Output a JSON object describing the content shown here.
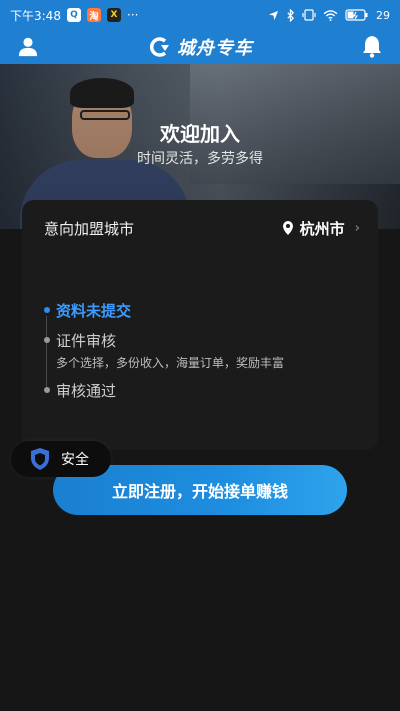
{
  "status_bar": {
    "time": "下午3:48",
    "more": "···",
    "battery": "29"
  },
  "header": {
    "brand": "城舟专车"
  },
  "hero": {
    "title": "欢迎加入",
    "subtitle": "时间灵活，多劳多得"
  },
  "city": {
    "label": "意向加盟城市",
    "value": "杭州市"
  },
  "steps": [
    {
      "label": "资料未提交",
      "active": true
    },
    {
      "label": "证件审核",
      "description": "多个选择，多份收入，海量订单，奖励丰富"
    },
    {
      "label": "审核通过"
    }
  ],
  "safety": {
    "label": "安全"
  },
  "cta": {
    "label": "立即注册，开始接单赚钱"
  },
  "colors": {
    "primary": "#1f7fd1",
    "active_step": "#3c9bff",
    "background": "#161616"
  }
}
